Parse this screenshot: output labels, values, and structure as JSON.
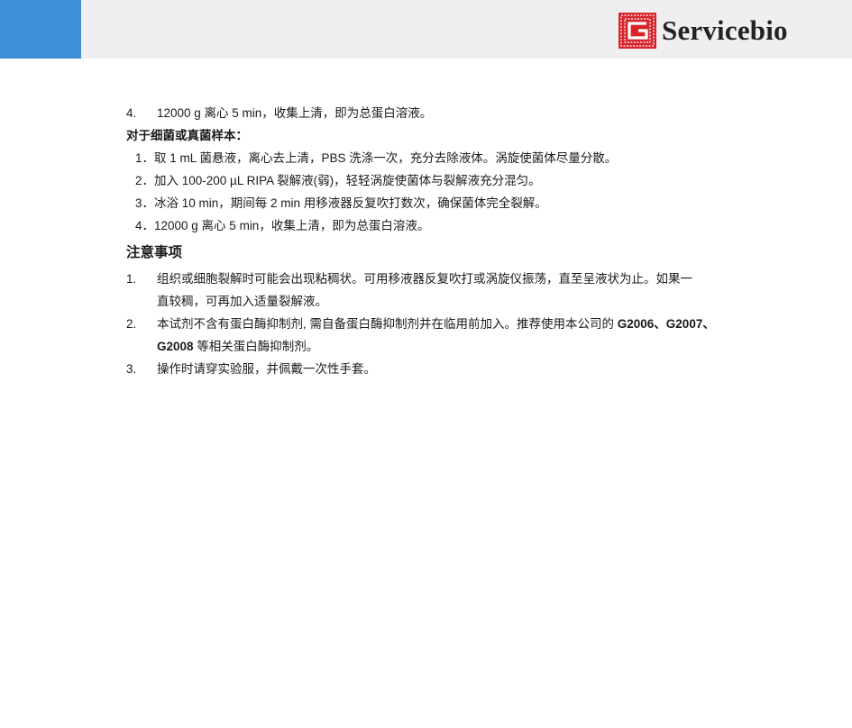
{
  "header": {
    "logo_text": "Servicebio",
    "logo_icon": "servicebio-logo-icon",
    "accent_color": "#3d8fd6",
    "logo_red": "#d7252b"
  },
  "step4": {
    "num": "4.",
    "text": "12000 g 离心 5 min，收集上清，即为总蛋白溶液。"
  },
  "bacteria": {
    "label": "对于细菌或真菌样本：",
    "steps": [
      "1．取 1 mL 菌悬液，离心去上清，PBS 洗涤一次，充分去除液体。涡旋使菌体尽量分散。",
      "2．加入 100-200 µL RIPA 裂解液(弱)，轻轻涡旋使菌体与裂解液充分混匀。",
      "3．冰浴 10 min，期间每 2 min 用移液器反复吹打数次，确保菌体完全裂解。",
      "4．12000 g 离心 5 min，收集上清，即为总蛋白溶液。"
    ]
  },
  "notes": {
    "heading": "注意事项",
    "items": [
      {
        "num": "1.",
        "line1": "组织或细胞裂解时可能会出现粘稠状。可用移液器反复吹打或涡旋仪振荡，直至呈液状为止。如果一",
        "line2": "直较稠，可再加入适量裂解液。"
      },
      {
        "num": "2.",
        "line1_pre": "本试剂不含有蛋白酶抑制剂, 需自备蛋白酶抑制剂并在临用前加入。推荐使用本公司的 ",
        "line1_bold": "G2006、G2007、",
        "line2_bold": "G2008",
        "line2_post": " 等相关蛋白酶抑制剂。"
      },
      {
        "num": "3.",
        "line1": "操作时请穿实验服，并佩戴一次性手套。"
      }
    ]
  }
}
